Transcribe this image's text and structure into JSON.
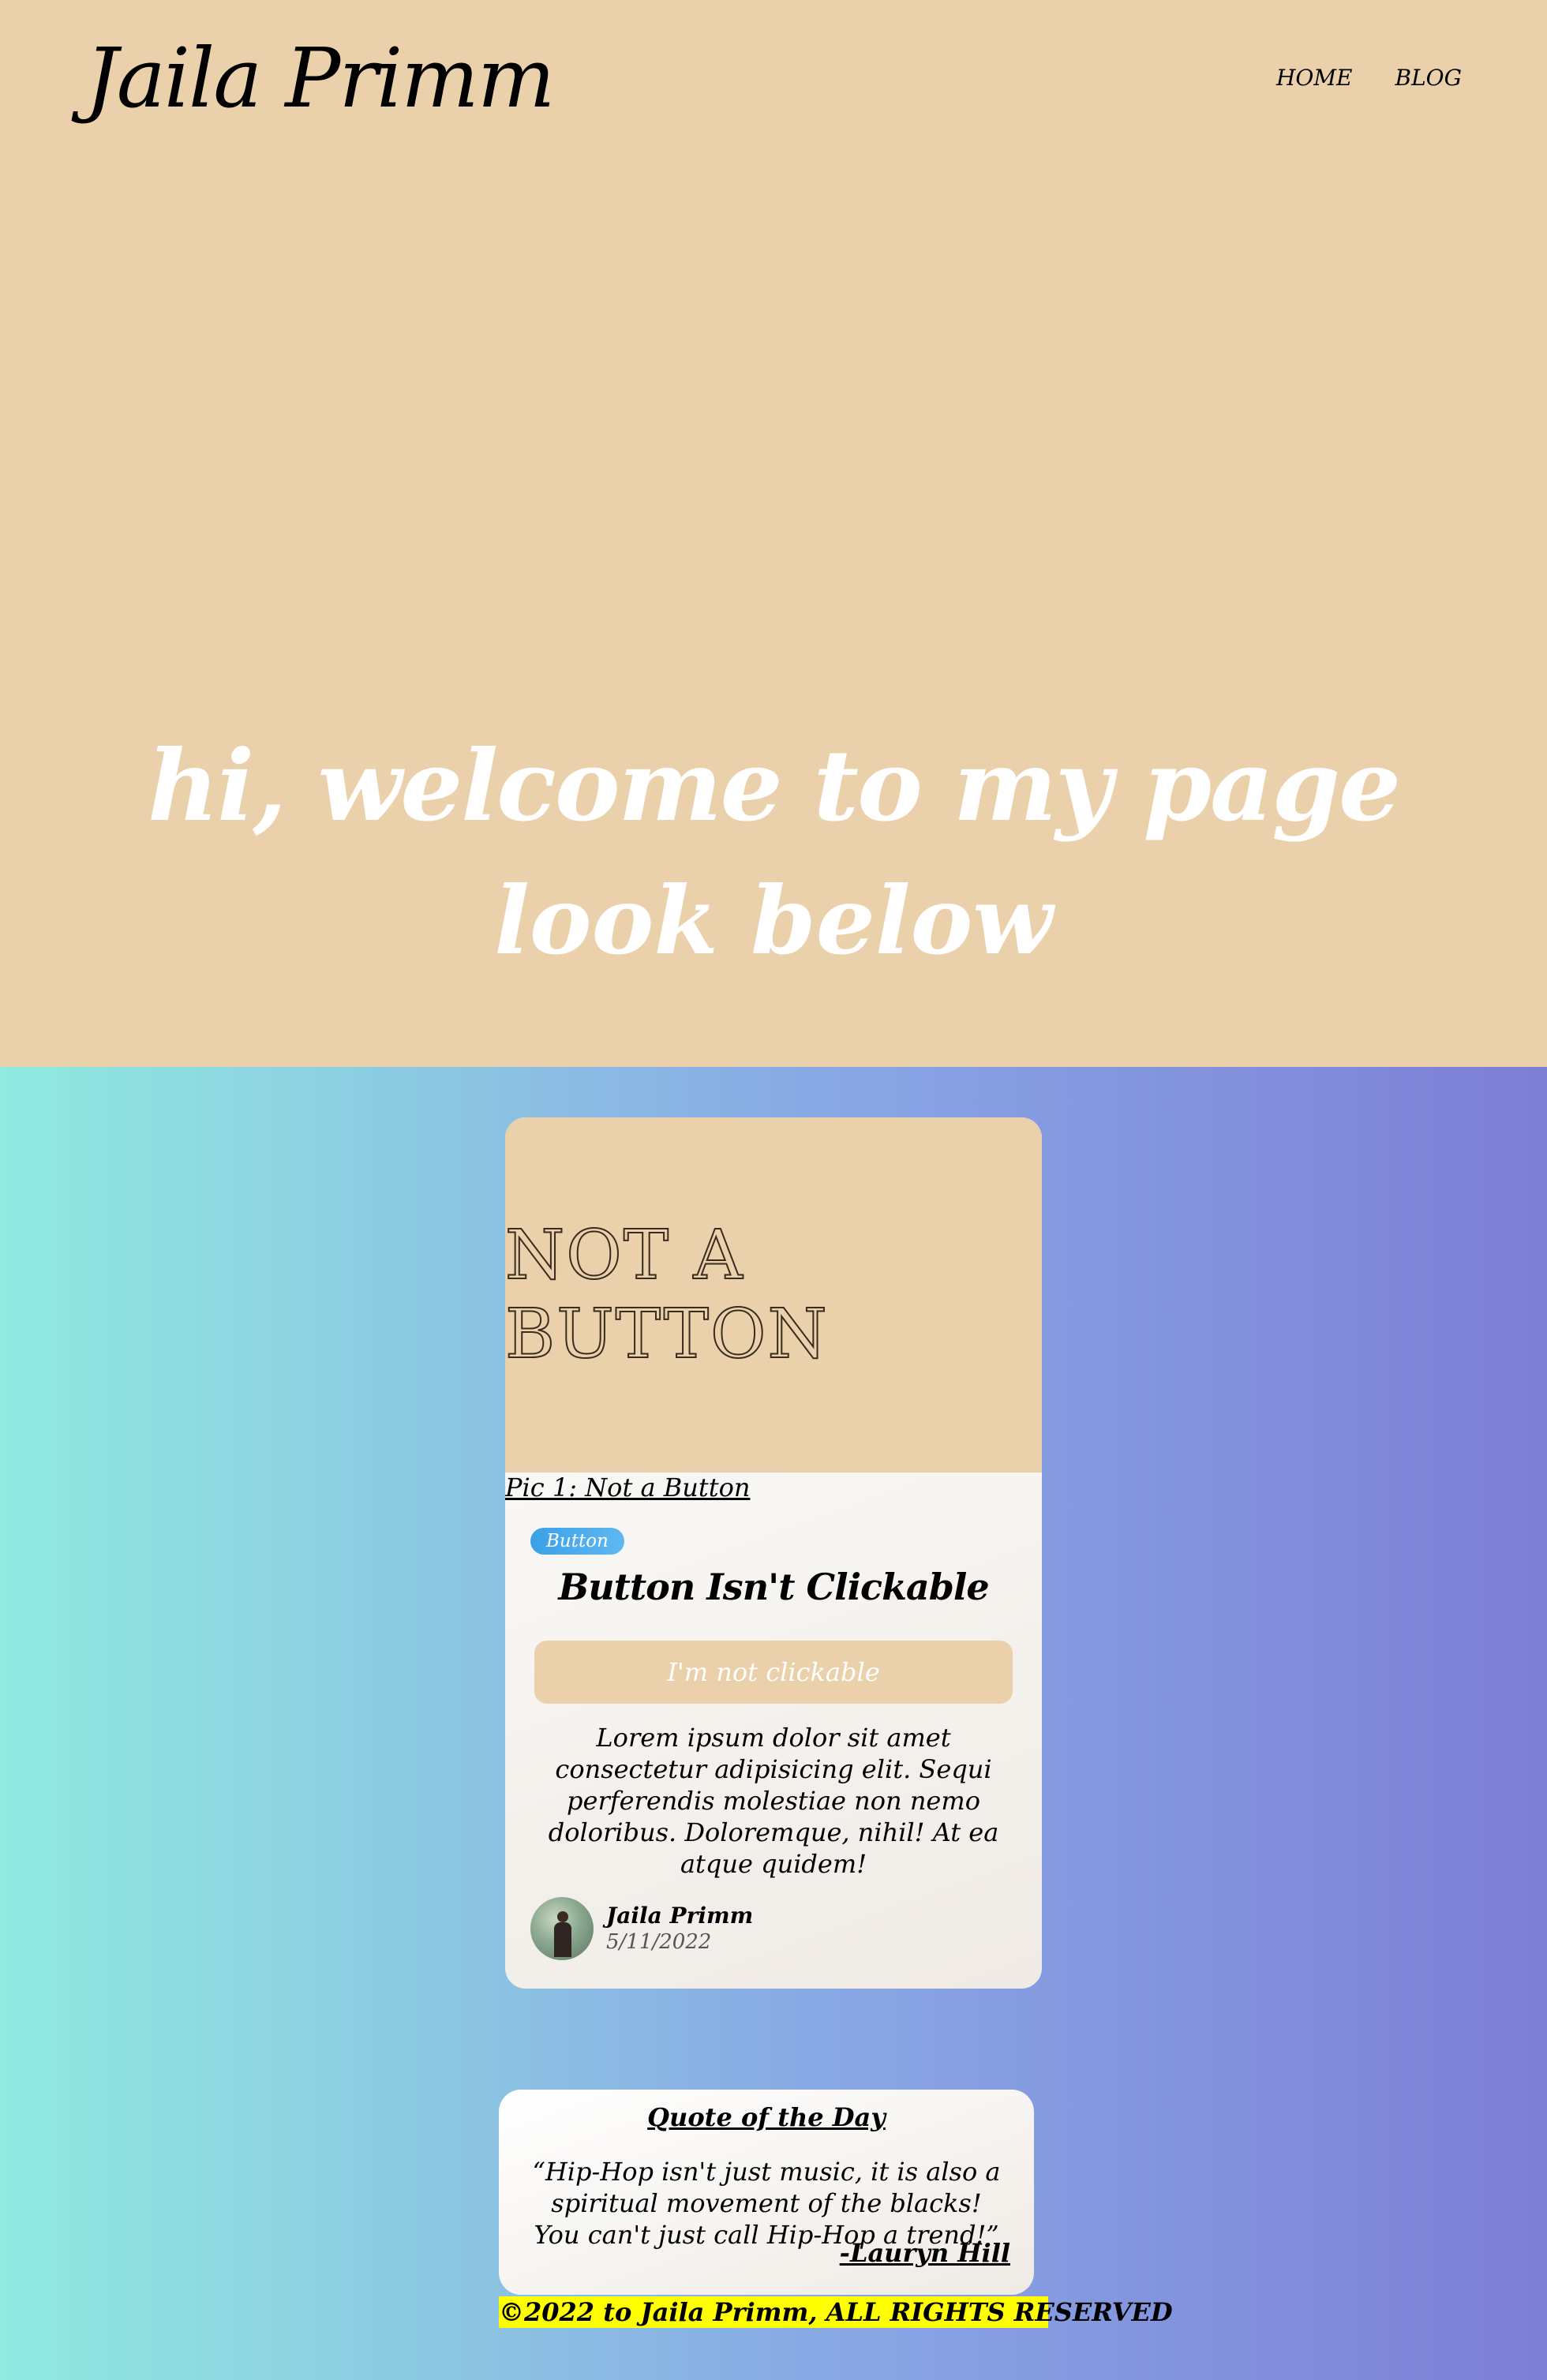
{
  "header": {
    "logo": "Jaila Primm",
    "nav": [
      {
        "label": "HOME"
      },
      {
        "label": "BLOG"
      }
    ]
  },
  "hero": {
    "line1": "hi, welcome to my page",
    "line2": "look below"
  },
  "card": {
    "image_text": "NOT A BUTTON",
    "caption": "Pic 1: Not a Button",
    "badge": "Button",
    "title": "Button Isn't Clickable",
    "button_label": "I'm not clickable",
    "text": "Lorem ipsum dolor sit amet consectetur adipisicing elit. Sequi perferendis molestiae non nemo doloribus. Doloremque, nihil! At ea atque quidem!",
    "author_name": "Jaila Primm",
    "author_date": "5/11/2022"
  },
  "quote": {
    "title": "Quote of the Day",
    "text": "“Hip-Hop isn't just music, it is also a spiritual movement of the blacks! You can't just call Hip-Hop a trend!”",
    "author": "-Lauryn Hill"
  },
  "footer": {
    "text": "©2022 to Jaila Primm, ALL RIGHTS RESERVED"
  },
  "colors": {
    "hero_background": "#ebd1ab",
    "gradient_start": "#90eae0",
    "gradient_end": "#7d7ed6",
    "footer_highlight": "#ffff00",
    "badge_blue": "#3ba0e8"
  }
}
